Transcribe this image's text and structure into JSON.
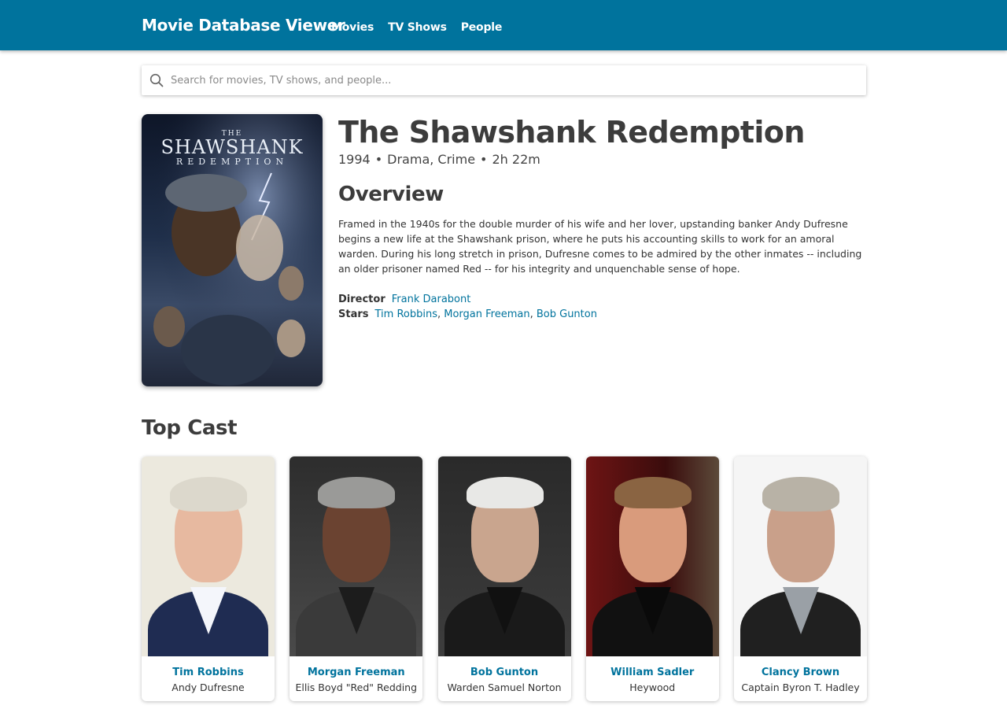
{
  "header": {
    "title": "Movie Database Viewer",
    "nav": [
      "Movies",
      "TV Shows",
      "People"
    ]
  },
  "search": {
    "placeholder": "Search for movies, TV shows, and people..."
  },
  "poster": {
    "line1": "THE",
    "line2": "SHAWSHANK",
    "line3": "REDEMPTION"
  },
  "movie": {
    "title": "The Shawshank Redemption",
    "year": "1994",
    "genres": "Drama, Crime",
    "runtime": "2h 22m",
    "separator": "•",
    "overview_heading": "Overview",
    "overview": "Framed in the 1940s for the double murder of his wife and her lover, upstanding banker Andy Dufresne begins a new life at the Shawshank prison, where he puts his accounting skills to work for an amoral warden. During his long stretch in prison, Dufresne comes to be admired by the other inmates -- including an older prisoner named Red -- for his integrity and unquenchable sense of hope.",
    "director_label": "Director",
    "director": "Frank Darabont",
    "stars_label": "Stars",
    "stars": [
      "Tim Robbins",
      "Morgan Freeman",
      "Bob Gunton"
    ]
  },
  "top_cast": {
    "heading": "Top Cast",
    "members": [
      {
        "name": "Tim Robbins",
        "role": "Andy Dufresne"
      },
      {
        "name": "Morgan Freeman",
        "role": "Ellis Boyd \"Red\" Redding"
      },
      {
        "name": "Bob Gunton",
        "role": "Warden Samuel Norton"
      },
      {
        "name": "William Sadler",
        "role": "Heywood"
      },
      {
        "name": "Clancy Brown",
        "role": "Captain Byron T. Hadley"
      }
    ]
  },
  "colors": {
    "header_bg": "#00739d",
    "link": "#00739d"
  }
}
